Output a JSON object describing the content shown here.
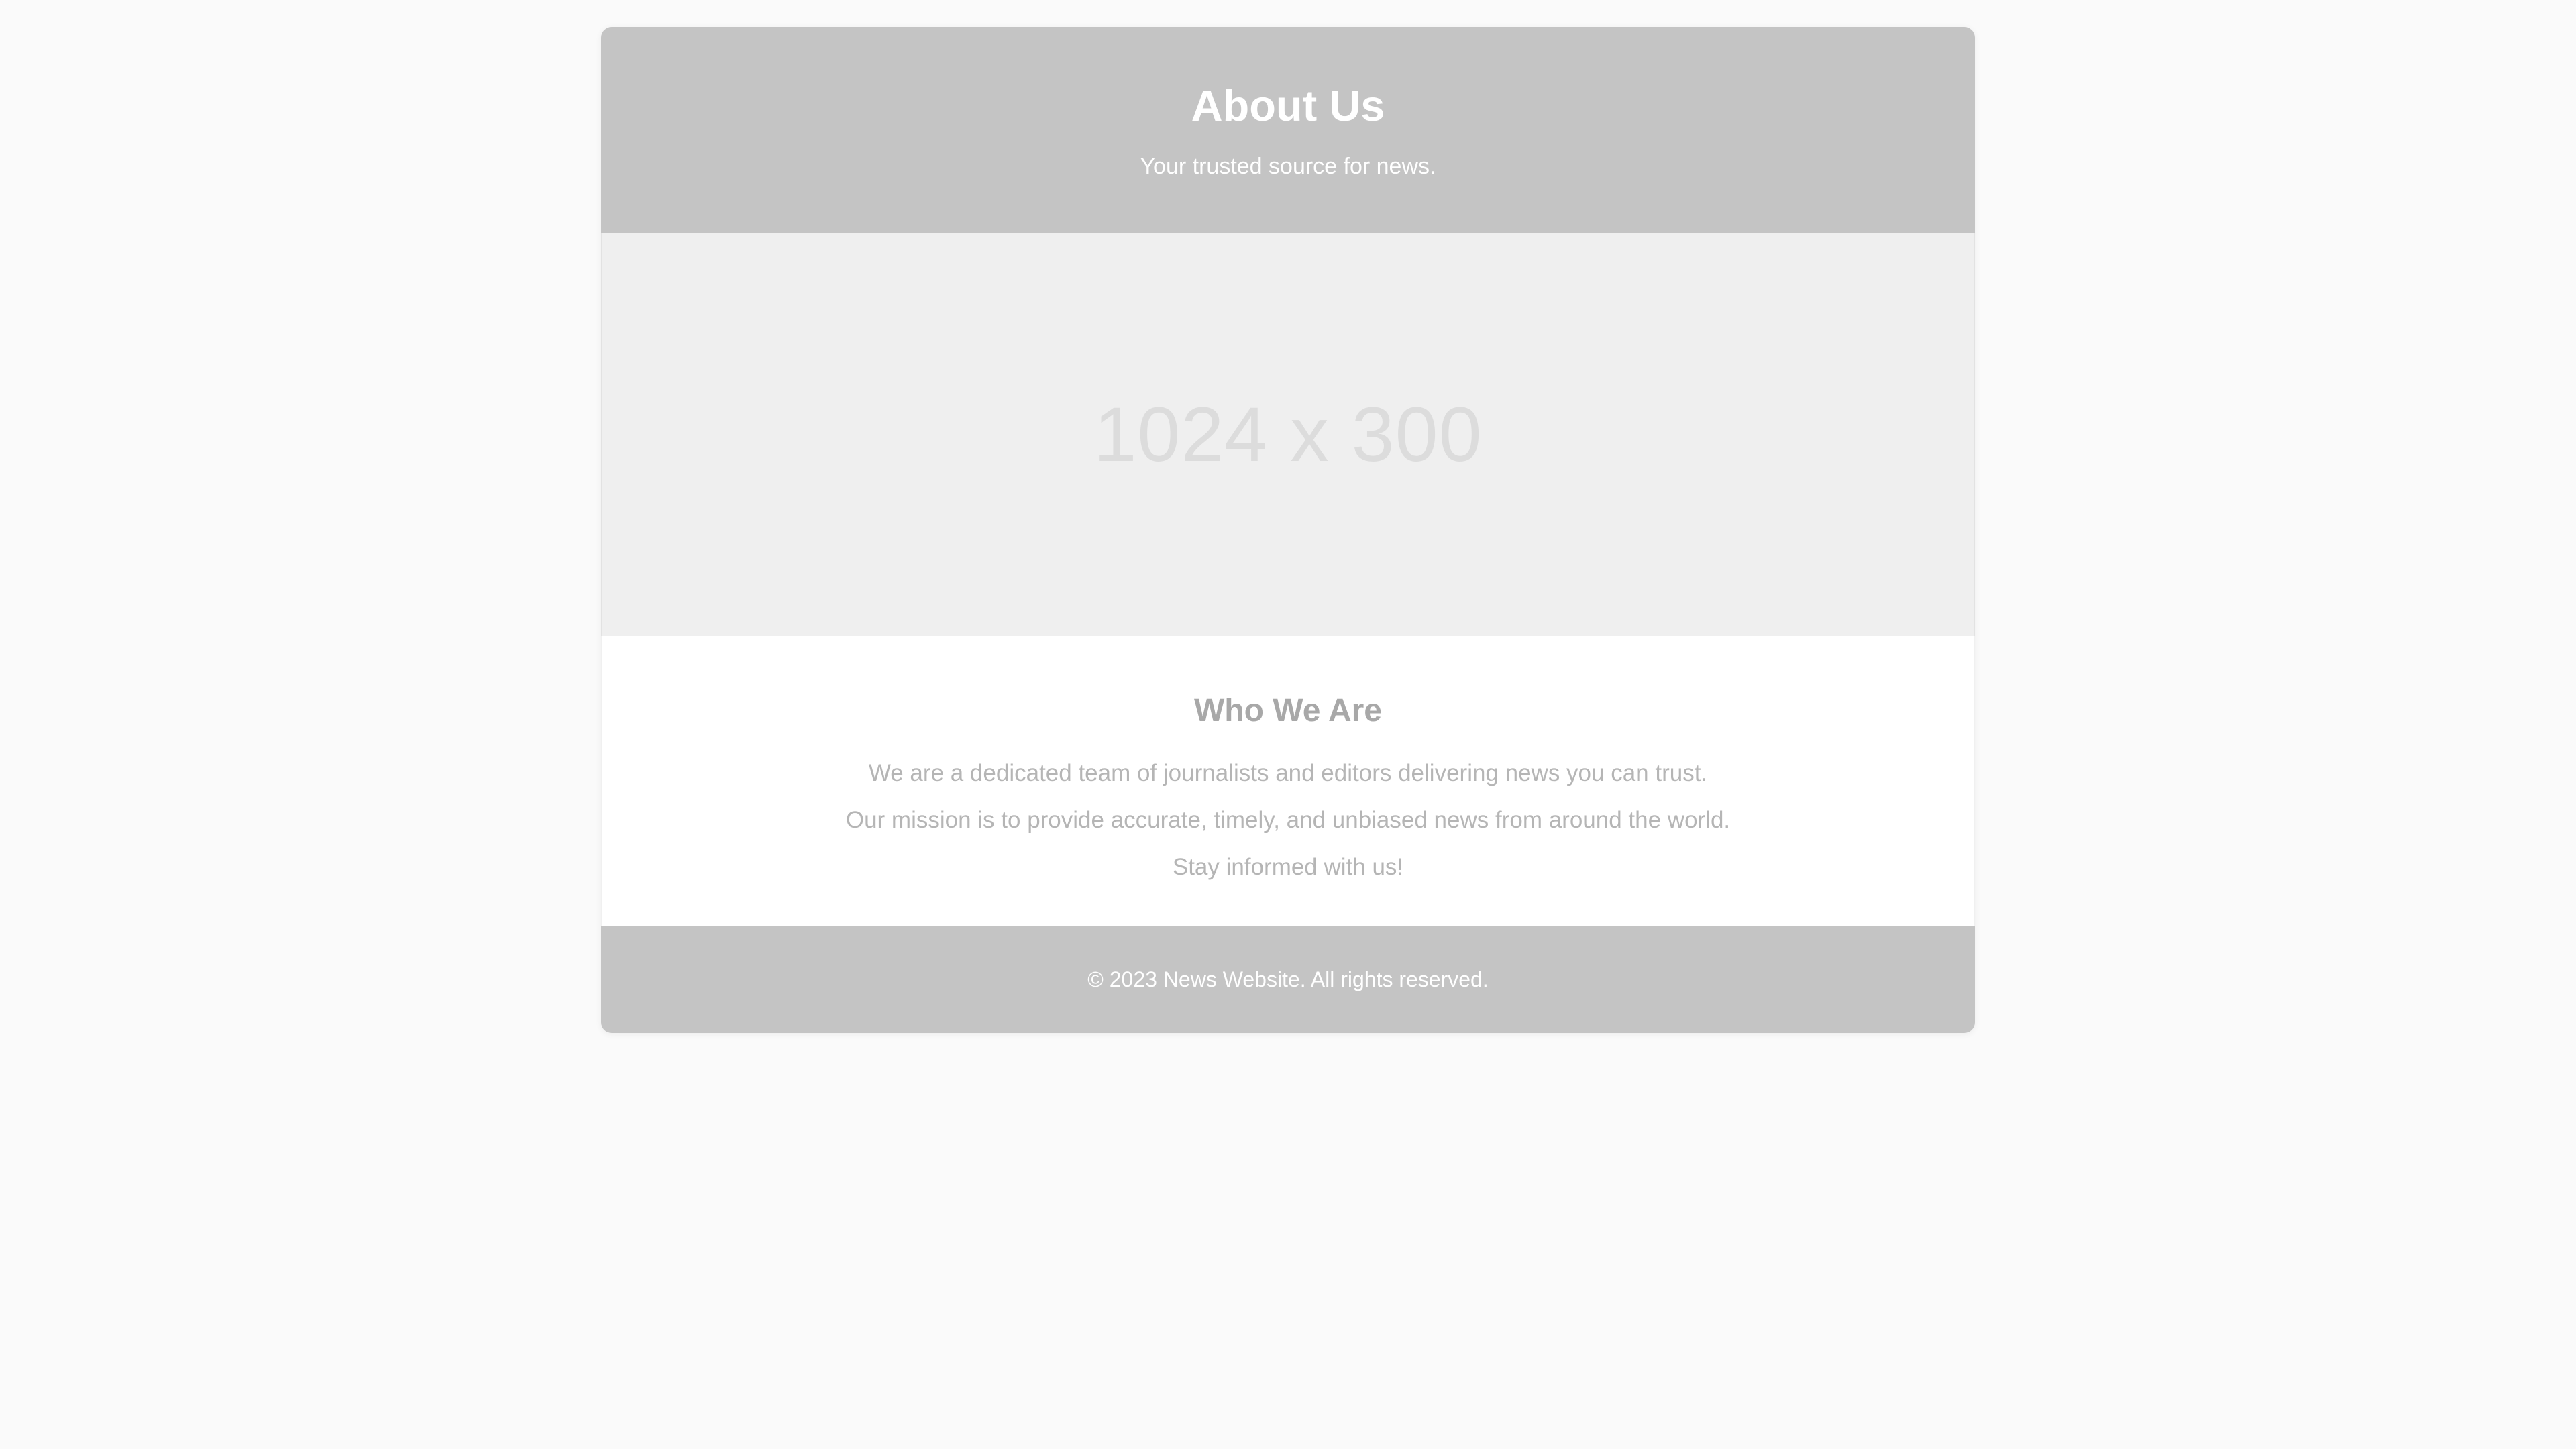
{
  "header": {
    "title": "About Us",
    "tagline": "Your trusted source for news."
  },
  "hero": {
    "placeholder_text": "1024 x 300"
  },
  "content": {
    "heading": "Who We Are",
    "paragraphs": [
      "We are a dedicated team of journalists and editors delivering news you can trust.",
      "Our mission is to provide accurate, timely, and unbiased news from around the world.",
      "Stay informed with us!"
    ]
  },
  "footer": {
    "copyright": "© 2023 News Website. All rights reserved."
  },
  "colors": {
    "page_background": "#fafafa",
    "header_background": "#c4c4c4",
    "hero_background": "#efefef",
    "heading_text": "#a8a8a8",
    "body_text": "#b5b5b5"
  }
}
